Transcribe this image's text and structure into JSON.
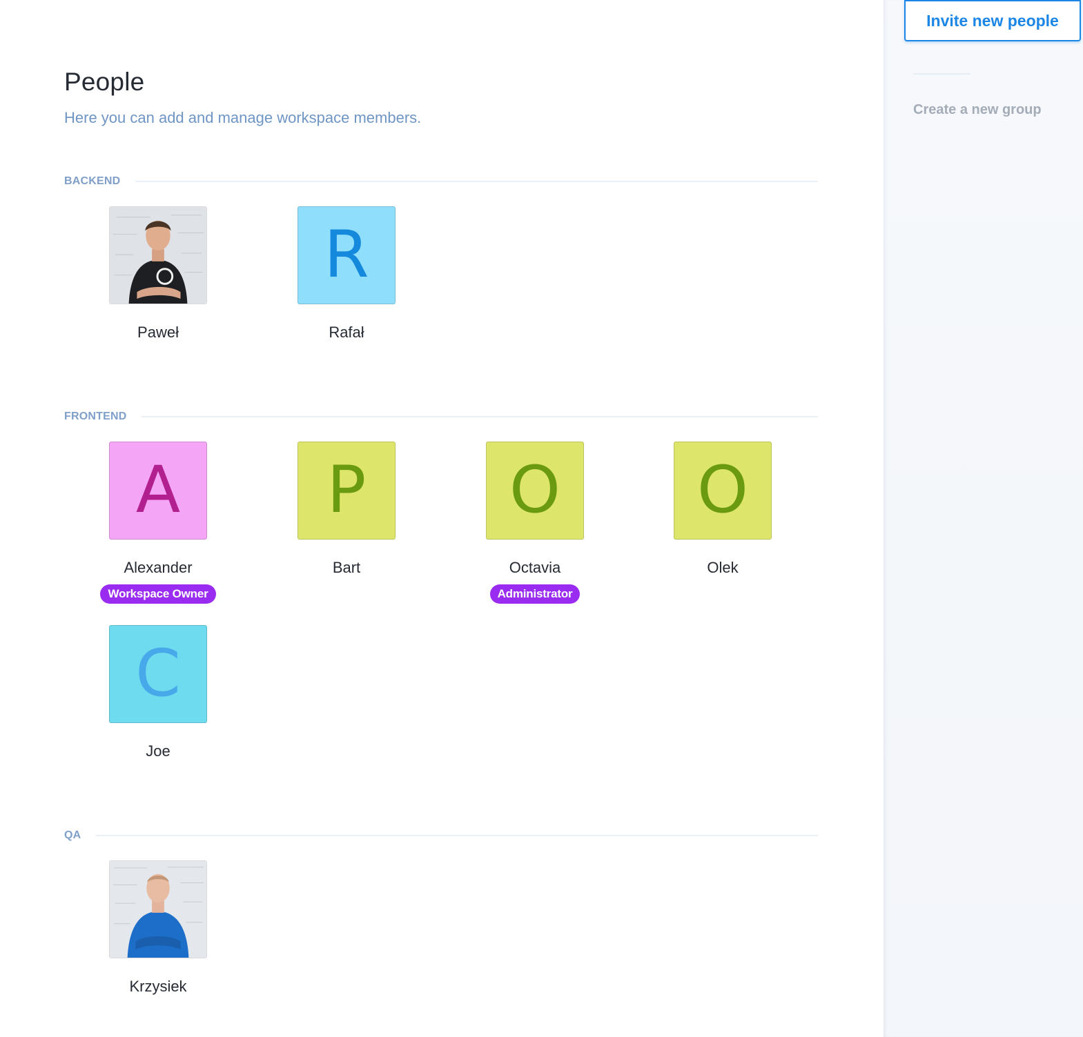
{
  "header": {
    "title": "People",
    "subtitle": "Here you can add and manage workspace members."
  },
  "groups": [
    {
      "name": "BACKEND",
      "members": [
        {
          "name": "Paweł",
          "avatar_type": "photo",
          "role": ""
        },
        {
          "name": "Rafał",
          "avatar_type": "initial",
          "initial": "R",
          "bg": "#8fdefc",
          "fg": "#1589dc",
          "role": ""
        }
      ]
    },
    {
      "name": "FRONTEND",
      "members": [
        {
          "name": "Alexander",
          "avatar_type": "initial",
          "initial": "A",
          "bg": "#f4a5f5",
          "fg": "#b2208f",
          "role": "Workspace Owner"
        },
        {
          "name": "Bart",
          "avatar_type": "initial",
          "initial": "P",
          "bg": "#dde66a",
          "fg": "#6a9a0f",
          "role": ""
        },
        {
          "name": "Octavia",
          "avatar_type": "initial",
          "initial": "O",
          "bg": "#dde66a",
          "fg": "#6a9a0f",
          "role": "Administrator"
        },
        {
          "name": "Olek",
          "avatar_type": "initial",
          "initial": "O",
          "bg": "#dde66a",
          "fg": "#6a9a0f",
          "role": ""
        },
        {
          "name": "Joe",
          "avatar_type": "initial",
          "initial": "C",
          "bg": "#6fdbef",
          "fg": "#47a8ea",
          "role": ""
        }
      ]
    },
    {
      "name": "QA",
      "members": [
        {
          "name": "Krzysiek",
          "avatar_type": "photo",
          "role": ""
        }
      ]
    }
  ],
  "sidebar": {
    "invite_label": "Invite new people",
    "create_group_label": "Create a new group"
  },
  "colors": {
    "accent": "#1b86e6",
    "badge": "#9a2bf0",
    "group_label": "#7f9fc9",
    "subtitle": "#6f95c4"
  }
}
